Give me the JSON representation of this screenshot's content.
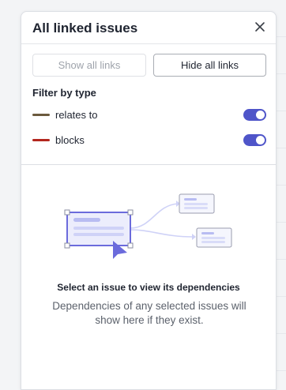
{
  "panel": {
    "title": "All linked issues",
    "close_icon": "close-icon"
  },
  "buttons": {
    "show_all_links": "Show all links",
    "hide_all_links": "Hide all links"
  },
  "filter": {
    "title": "Filter by type",
    "items": [
      {
        "label": "relates to",
        "color": "#6b5a3d",
        "enabled": true
      },
      {
        "label": "blocks",
        "color": "#b3261e",
        "enabled": true
      }
    ]
  },
  "empty_state": {
    "illustration_icon": "dependency-graph-icon",
    "title": "Select an issue to view its dependencies",
    "description": "Dependencies of any selected issues will show here if they exist."
  },
  "colors": {
    "accent": "#4f55c9",
    "illustration_primary": "#6b6bdc",
    "illustration_light": "#cfd2f7"
  }
}
